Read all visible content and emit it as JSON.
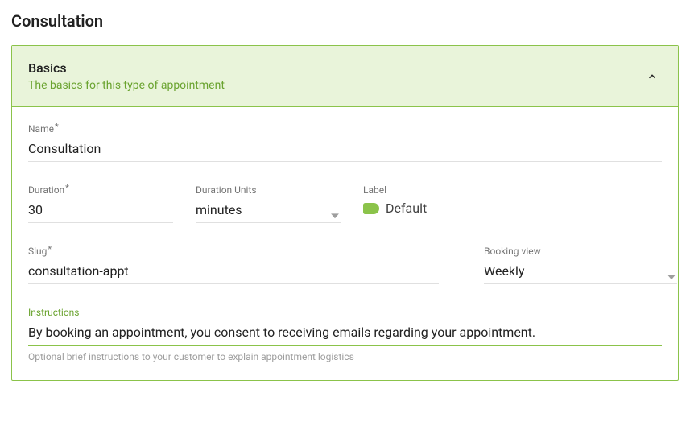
{
  "page_title": "Consultation",
  "panel": {
    "title": "Basics",
    "subtitle": "The basics for this type of appointment"
  },
  "fields": {
    "name": {
      "label": "Name",
      "value": "Consultation"
    },
    "duration": {
      "label": "Duration",
      "value": "30"
    },
    "duration_units": {
      "label": "Duration Units",
      "value": "minutes"
    },
    "label": {
      "label": "Label",
      "value": "Default"
    },
    "slug": {
      "label": "Slug",
      "value": "consultation-appt"
    },
    "booking_view": {
      "label": "Booking view",
      "value": "Weekly"
    },
    "instructions": {
      "label": "Instructions",
      "value": "By booking an appointment, you consent to receiving emails regarding your appointment.",
      "helper": "Optional brief instructions to your customer to explain appointment logistics"
    }
  }
}
